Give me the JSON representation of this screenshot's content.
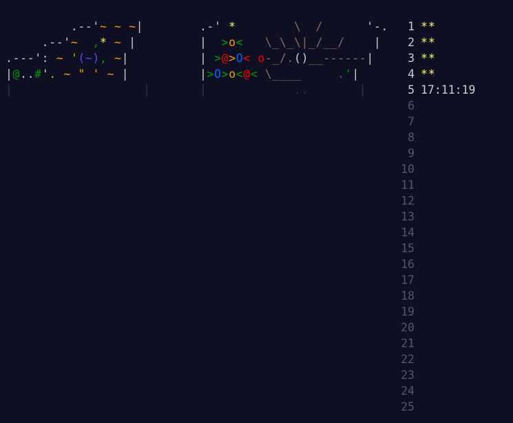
{
  "art_left": [
    [
      {
        "t": "         .--'",
        "c": "#cccccc"
      },
      {
        "t": "~ ~ ~",
        "c": "#ff9900"
      },
      {
        "t": "|",
        "c": "#cccccc"
      }
    ],
    [
      {
        "t": "     .--'",
        "c": "#cccccc"
      },
      {
        "t": "~  ",
        "c": "#ff9900"
      },
      {
        "t": ",",
        "c": "#009900"
      },
      {
        "t": "*",
        "c": "#ffff66"
      },
      {
        "t": " ~ ",
        "c": "#ff9900"
      },
      {
        "t": "|",
        "c": "#cccccc"
      }
    ],
    [
      {
        "t": ".---':",
        "c": "#cccccc"
      },
      {
        "t": " ~ ",
        "c": "#ff9900"
      },
      {
        "t": "'",
        "c": "#ff9900"
      },
      {
        "t": "(~)",
        "c": "#4d4dff"
      },
      {
        "t": ",",
        "c": "#009900"
      },
      {
        "t": " ~",
        "c": "#ff9900"
      },
      {
        "t": "|",
        "c": "#cccccc"
      }
    ],
    [
      {
        "t": "|",
        "c": "#cccccc"
      },
      {
        "t": "@",
        "c": "#009900"
      },
      {
        "t": "..",
        "c": "#cccccc"
      },
      {
        "t": "#",
        "c": "#009900"
      },
      {
        "t": "'",
        "c": "#cccccc"
      },
      {
        "t": ". ~ \" ' ~ ",
        "c": "#ff9900"
      },
      {
        "t": "|",
        "c": "#cccccc"
      }
    ],
    [
      {
        "t": "|",
        "c": "#333344"
      },
      {
        "t": "                  ",
        "c": "#333344"
      },
      {
        "t": "|",
        "c": "#333344"
      }
    ]
  ],
  "art_right": [
    [
      {
        "t": ".-' ",
        "c": "#cccccc"
      },
      {
        "t": "*",
        "c": "#ffff66"
      },
      {
        "t": "        \\  /      ",
        "c": "#8c6a5a"
      },
      {
        "t": "'-.",
        "c": "#cccccc"
      }
    ],
    [
      {
        "t": "|  ",
        "c": "#cccccc"
      },
      {
        "t": ">",
        "c": "#009900"
      },
      {
        "t": "o",
        "c": "#ff9900"
      },
      {
        "t": "<",
        "c": "#009900"
      },
      {
        "t": "   \\_\\_\\|_/__/    ",
        "c": "#8c6a5a"
      },
      {
        "t": "|",
        "c": "#cccccc"
      }
    ],
    [
      {
        "t": "| ",
        "c": "#cccccc"
      },
      {
        "t": ">",
        "c": "#009900"
      },
      {
        "t": "@",
        "c": "#ff0000"
      },
      {
        "t": ">",
        "c": "#ff9900"
      },
      {
        "t": "O",
        "c": "#0066ff"
      },
      {
        "t": "<",
        "c": "#ff0000"
      },
      {
        "t": " ",
        "c": "#cccccc"
      },
      {
        "t": "o",
        "c": "#ff0000"
      },
      {
        "t": "-_/.",
        "c": "#8c6a5a"
      },
      {
        "t": "()",
        "c": "#cccccc"
      },
      {
        "t": "__------",
        "c": "#8c6a5a"
      },
      {
        "t": "|",
        "c": "#cccccc"
      }
    ],
    [
      {
        "t": "|",
        "c": "#cccccc"
      },
      {
        "t": ">",
        "c": "#009900"
      },
      {
        "t": "O",
        "c": "#0066ff"
      },
      {
        "t": ">",
        "c": "#009900"
      },
      {
        "t": "o",
        "c": "#ff9900"
      },
      {
        "t": "<",
        "c": "#009900"
      },
      {
        "t": "@",
        "c": "#ff0000"
      },
      {
        "t": "<",
        "c": "#009900"
      },
      {
        "t": " \\____     ",
        "c": "#8c6a5a"
      },
      {
        "t": ".'",
        "c": "#009900"
      },
      {
        "t": "|",
        "c": "#cccccc"
      }
    ],
    [
      {
        "t": "|",
        "c": "#333344"
      },
      {
        "t": "            ..       ",
        "c": "#333344"
      },
      {
        "t": "|",
        "c": "#333344"
      }
    ]
  ],
  "days": [
    {
      "num": "1",
      "stars": "**"
    },
    {
      "num": "2",
      "stars": "**"
    },
    {
      "num": "3",
      "stars": "**"
    },
    {
      "num": "4",
      "stars": "**"
    },
    {
      "num": "5",
      "timer": "17:11:19"
    },
    {
      "num": "6"
    },
    {
      "num": "7"
    },
    {
      "num": "8"
    },
    {
      "num": "9"
    },
    {
      "num": "10"
    },
    {
      "num": "11"
    },
    {
      "num": "12"
    },
    {
      "num": "13"
    },
    {
      "num": "14"
    },
    {
      "num": "15"
    },
    {
      "num": "16"
    },
    {
      "num": "17"
    },
    {
      "num": "18"
    },
    {
      "num": "19"
    },
    {
      "num": "20"
    },
    {
      "num": "21"
    },
    {
      "num": "22"
    },
    {
      "num": "23"
    },
    {
      "num": "24"
    },
    {
      "num": "25"
    }
  ],
  "colors": {
    "background": "#0f0f23",
    "text": "#cccccc",
    "star": "#ffff66",
    "locked": "#555566"
  }
}
